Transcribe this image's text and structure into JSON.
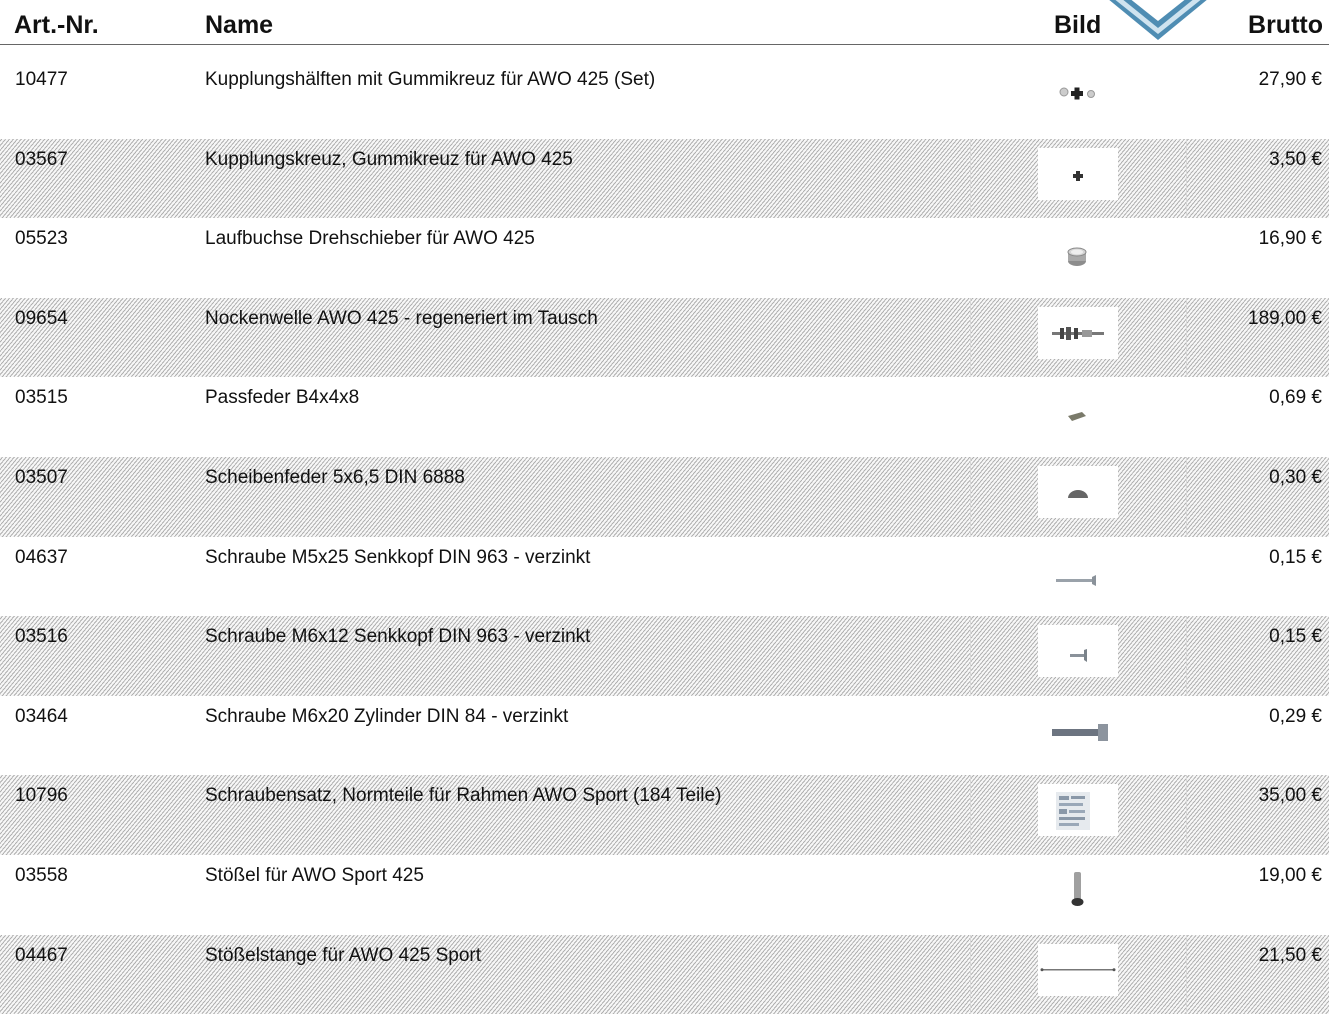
{
  "header": {
    "art_nr": "Art.-Nr.",
    "name": "Name",
    "bild": "Bild",
    "brutto": "Brutto"
  },
  "rows": [
    {
      "art": "10477",
      "name": "Kupplungshälften mit Gummikreuz für AWO 425 (Set)",
      "price": "27,90 €",
      "icon": "coupling-set-icon"
    },
    {
      "art": "03567",
      "name": "Kupplungskreuz, Gummikreuz für AWO 425",
      "price": "3,50 €",
      "icon": "rubber-cross-icon"
    },
    {
      "art": "05523",
      "name": "Laufbuchse Drehschieber für AWO 425",
      "price": "16,90 €",
      "icon": "bushing-icon"
    },
    {
      "art": "09654",
      "name": "Nockenwelle AWO 425 - regeneriert im Tausch",
      "price": "189,00 €",
      "icon": "camshaft-icon"
    },
    {
      "art": "03515",
      "name": "Passfeder B4x4x8",
      "price": "0,69 €",
      "icon": "key-feather-icon"
    },
    {
      "art": "03507",
      "name": "Scheibenfeder 5x6,5 DIN 6888",
      "price": "0,30 €",
      "icon": "woodruff-key-icon"
    },
    {
      "art": "04637",
      "name": "Schraube M5x25 Senkkopf DIN 963 - verzinkt",
      "price": "0,15 €",
      "icon": "countersunk-screw-long-icon"
    },
    {
      "art": "03516",
      "name": "Schraube M6x12 Senkkopf DIN 963 - verzinkt",
      "price": "0,15 €",
      "icon": "countersunk-screw-short-icon"
    },
    {
      "art": "03464",
      "name": "Schraube M6x20 Zylinder DIN 84 - verzinkt",
      "price": "0,29 €",
      "icon": "cheese-head-screw-icon"
    },
    {
      "art": "10796",
      "name": "Schraubensatz, Normteile für Rahmen AWO Sport (184 Teile)",
      "price": "35,00 €",
      "icon": "screw-set-icon"
    },
    {
      "art": "03558",
      "name": "Stößel für AWO Sport 425",
      "price": "19,00 €",
      "icon": "tappet-icon"
    },
    {
      "art": "04467",
      "name": "Stößelstange für AWO 425 Sport",
      "price": "21,50 €",
      "icon": "pushrod-icon"
    }
  ]
}
